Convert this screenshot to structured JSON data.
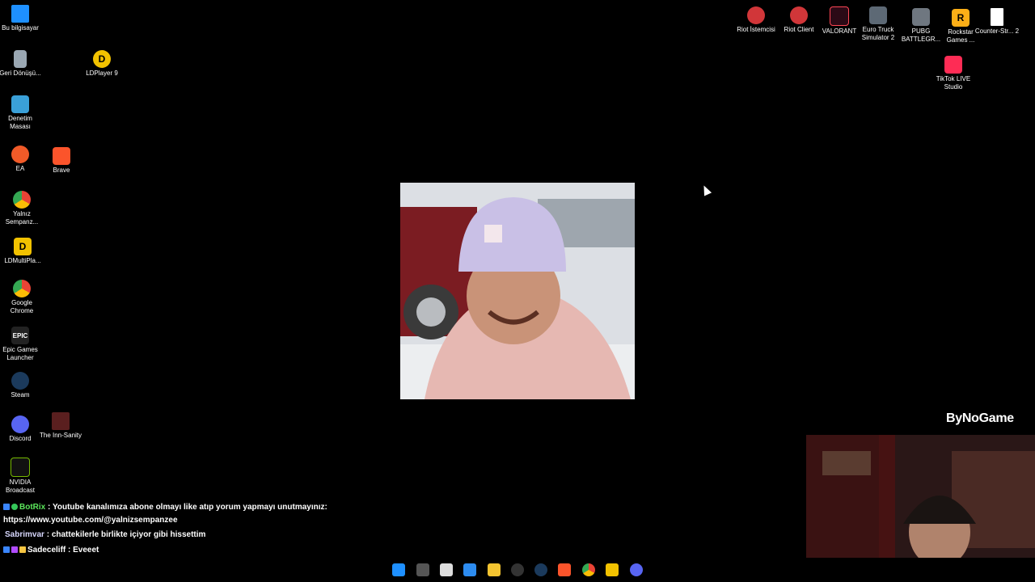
{
  "desktop": {
    "left_icons": [
      {
        "name": "Bu bilgisayar"
      },
      {
        "name": "Geri Dönüşü..."
      },
      {
        "name": "Denetim Masası"
      },
      {
        "name": "EA"
      },
      {
        "name": "Yalnız Sempanz..."
      },
      {
        "name": "LDMultiPla..."
      },
      {
        "name": "Google Chrome"
      },
      {
        "name": "Epic Games Launcher"
      },
      {
        "name": "Steam"
      },
      {
        "name": "Discord"
      },
      {
        "name": "NVIDIA Broadcast"
      },
      {
        "name": "LDPlayer 9"
      },
      {
        "name": "Brave"
      },
      {
        "name": "The Inn-Sanity"
      }
    ],
    "right_icons": [
      {
        "name": "Riot İstemcisi"
      },
      {
        "name": "Riot Client"
      },
      {
        "name": "VALORANT"
      },
      {
        "name": "Euro Truck Simulator 2"
      },
      {
        "name": "PUBG BATTLEGR..."
      },
      {
        "name": "Rockstar Games ..."
      },
      {
        "name": "Counter-Str... 2"
      },
      {
        "name": "TikTok LIVE Studio"
      }
    ]
  },
  "overlay": {
    "brand": "ByNoGame"
  },
  "chat": [
    {
      "user": "BotRix",
      "sep": " : ",
      "text": "Youtube kanalımıza abone olmayı like atıp yorum yapmayı unutmayınız:"
    },
    {
      "user": "",
      "sep": "",
      "text": "https://www.youtube.com/@yalnizsempanzee"
    },
    {
      "user": "Sabrimvar",
      "sep": " : ",
      "text": "chattekilerle birlikte içiyor gibi hissettim"
    },
    {
      "user": "Sadeceliff",
      "sep": " : ",
      "text": "Eveeet"
    }
  ],
  "taskbar": {
    "icons": [
      "windows-start",
      "task-view",
      "snipping-tool",
      "photos",
      "file-explorer",
      "obs",
      "steam",
      "brave",
      "chrome",
      "ldplayer",
      "discord"
    ]
  }
}
